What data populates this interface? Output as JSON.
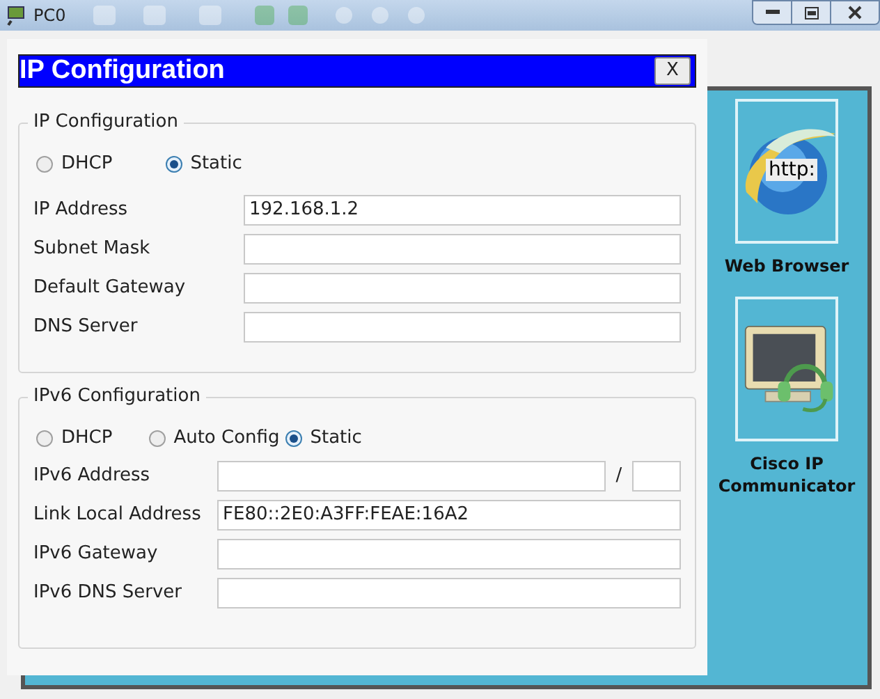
{
  "window": {
    "title": "PC0"
  },
  "dialog": {
    "title": "IP Configuration",
    "close": "X",
    "ipv4": {
      "title": "IP Configuration",
      "modes": [
        {
          "label": "DHCP",
          "selected": false
        },
        {
          "label": "Static",
          "selected": true
        }
      ],
      "fields": [
        {
          "label": "IP Address",
          "value": "192.168.1.2"
        },
        {
          "label": "Subnet Mask"
        },
        {
          "label": "Default Gateway"
        },
        {
          "label": "DNS Server"
        }
      ]
    },
    "ipv6": {
      "title": "IPv6 Configuration",
      "modes": [
        {
          "label": "DHCP",
          "selected": false
        },
        {
          "label": "Auto Config",
          "selected": false
        },
        {
          "label": "Static",
          "selected": true
        }
      ],
      "address": {
        "label": "IPv6 Address",
        "separator": "/"
      },
      "fields": [
        {
          "label": "Link Local Address",
          "value": "FE80::2E0:A3FF:FEAE:16A2"
        },
        {
          "label": "IPv6 Gateway"
        },
        {
          "label": "IPv6 DNS Server"
        }
      ]
    }
  },
  "desktop": {
    "apps": [
      {
        "kind": "browser",
        "label": "Web Browser",
        "badge": "http:"
      },
      {
        "kind": "phone",
        "label": "Cisco IP Communicator"
      }
    ]
  }
}
